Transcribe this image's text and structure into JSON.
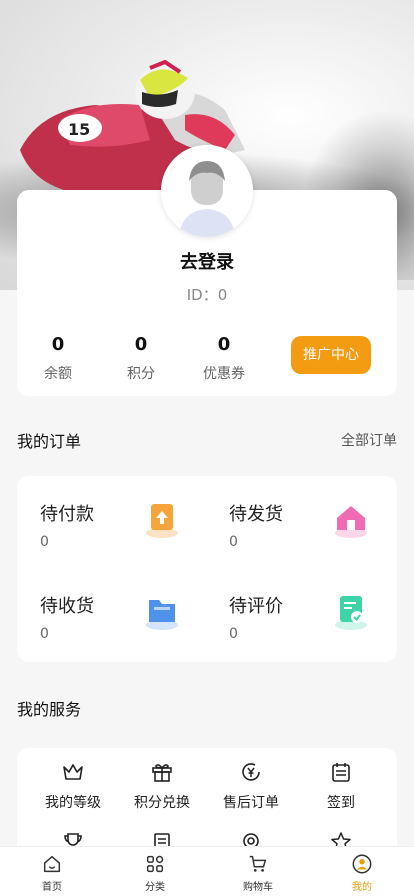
{
  "profile": {
    "login_label": "去登录",
    "id_text": "ID：0",
    "stats": [
      {
        "value": "0",
        "label": "余额"
      },
      {
        "value": "0",
        "label": "积分"
      },
      {
        "value": "0",
        "label": "优惠券"
      }
    ],
    "promo_button": "推广中心"
  },
  "orders": {
    "title": "我的订单",
    "all_link": "全部订单",
    "items": [
      {
        "label": "待付款",
        "count": "0",
        "icon": "payment-icon"
      },
      {
        "label": "待发货",
        "count": "0",
        "icon": "house-icon"
      },
      {
        "label": "待收货",
        "count": "0",
        "icon": "folder-icon"
      },
      {
        "label": "待评价",
        "count": "0",
        "icon": "review-icon"
      }
    ]
  },
  "services": {
    "title": "我的服务",
    "items": [
      {
        "label": "我的等级",
        "icon": "crown-icon"
      },
      {
        "label": "积分兑换",
        "icon": "gift-icon"
      },
      {
        "label": "售后订单",
        "icon": "yen-refund-icon"
      },
      {
        "label": "签到",
        "icon": "calendar-icon"
      },
      {
        "label": "",
        "icon": "trophy-icon"
      },
      {
        "label": "",
        "icon": "list-icon"
      },
      {
        "label": "",
        "icon": "location-icon"
      },
      {
        "label": "",
        "icon": "star-icon"
      }
    ]
  },
  "tabbar": {
    "items": [
      {
        "label": "首页",
        "icon": "home-icon"
      },
      {
        "label": "分类",
        "icon": "grid-icon"
      },
      {
        "label": "购物车",
        "icon": "cart-icon"
      },
      {
        "label": "我的",
        "icon": "user-icon",
        "active": true
      }
    ]
  },
  "colors": {
    "accent": "#f39c12",
    "active_tab": "#e8a10c"
  }
}
